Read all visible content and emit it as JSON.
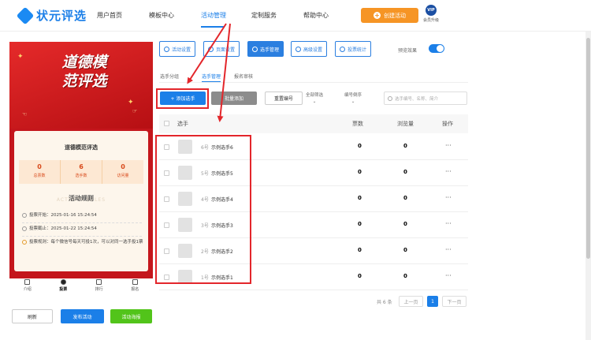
{
  "brand": {
    "name": "状元评选"
  },
  "nav": {
    "items": [
      "用户首页",
      "模板中心",
      "活动管理",
      "定制服务",
      "帮助中心"
    ],
    "active_index": 2,
    "create_label": "创建活动",
    "vip_badge": "VIP",
    "vip_label": "会员升级"
  },
  "preview": {
    "banner_title_line1": "道德模",
    "banner_title_line2": "范评选",
    "card_title": "道德模范评选",
    "stats": [
      {
        "value": "0",
        "label": "总票数"
      },
      {
        "value": "6",
        "label": "选手数"
      },
      {
        "value": "0",
        "label": "访问量"
      }
    ],
    "rules_title": "活动规则",
    "rules_en": "ACTIVITY RULES",
    "rules": [
      "投票开始：2025-01-16 15:24:54",
      "投票截止：2025-01-22 15:24:54",
      "投票规则：每个微信号每天可投1次，可以对同一选手投1票"
    ],
    "tabbar": [
      "介绍",
      "投票",
      "排行",
      "报名"
    ],
    "tabbar_active": 1
  },
  "actions": {
    "refresh": "刷新",
    "publish": "发布活动",
    "poster": "活动海报"
  },
  "toolbar": {
    "buttons": [
      "活动设置",
      "页面设置",
      "选手管理",
      "高级设置",
      "投票统计"
    ],
    "active_index": 2,
    "preview_label": "预览效果",
    "preview_on": true
  },
  "subtabs": {
    "items": [
      "选手分组",
      "选手管理",
      "报名审核"
    ],
    "active_index": 1
  },
  "controls": {
    "add": "+ 添加选手",
    "batch": "批量添加",
    "renumber": "重置编号",
    "filter_all": "全部筛选",
    "sort": "编号倒序",
    "search_placeholder": "选手编号、名称、简介"
  },
  "table": {
    "columns": [
      "选手",
      "票数",
      "浏览量",
      "操作"
    ],
    "rows": [
      {
        "no": "6号",
        "name": "示例选手6",
        "votes": "0",
        "views": "0"
      },
      {
        "no": "5号",
        "name": "示例选手5",
        "votes": "0",
        "views": "0"
      },
      {
        "no": "4号",
        "name": "示例选手4",
        "votes": "0",
        "views": "0"
      },
      {
        "no": "3号",
        "name": "示例选手3",
        "votes": "0",
        "views": "0"
      },
      {
        "no": "2号",
        "name": "示例选手2",
        "votes": "0",
        "views": "0"
      },
      {
        "no": "1号",
        "name": "示例选手1",
        "votes": "0",
        "views": "0"
      }
    ],
    "more": "···"
  },
  "pager": {
    "total": "共 6 条",
    "prev": "上一页",
    "current": "1",
    "next": "下一页"
  },
  "colors": {
    "primary": "#1b7fe8",
    "orange": "#f69525",
    "green": "#52c41a",
    "annotation": "#e3262b",
    "banner_red": "#c4161c"
  }
}
